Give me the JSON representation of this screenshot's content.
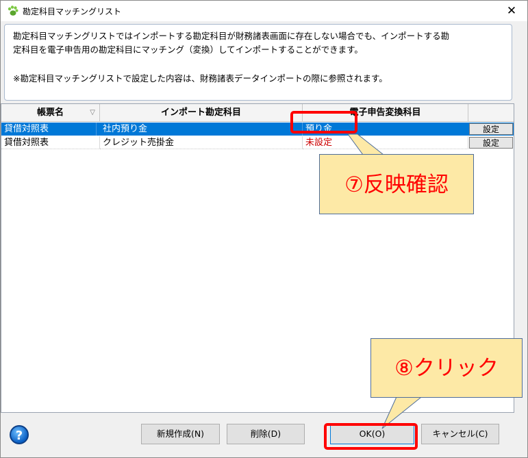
{
  "window": {
    "title": "勘定科目マッチングリスト",
    "close_glyph": "✕"
  },
  "info": {
    "line1": "勘定科目マッチングリストではインポートする勘定科目が財務諸表画面に存在しない場合でも、インポートする勘",
    "line2": "定科目を電子申告用の勘定科目にマッチング（変換）してインポートすることができます。",
    "line3": "※勘定科目マッチングリストで設定した内容は、財務諸表データインポートの際に参照されます。"
  },
  "table": {
    "columns": [
      "帳票名",
      "インポート勘定科目",
      "電子申告変換科目",
      ""
    ],
    "sort_glyph": "▽",
    "rows": [
      {
        "form": "貸借対照表",
        "import_account": "社内預り金",
        "converted": "預り金",
        "button": "設定",
        "selected": true
      },
      {
        "form": "貸借対照表",
        "import_account": "クレジット売掛金",
        "converted": "未設定",
        "button": "設定",
        "selected": false
      }
    ]
  },
  "buttons": {
    "new": "新規作成(N)",
    "delete": "削除(D)",
    "ok": "OK(O)",
    "cancel": "キャンセル(C)",
    "help": "?"
  },
  "annotations": {
    "callout1": "⑦反映確認",
    "callout2": "⑧クリック"
  },
  "colors": {
    "selected_row": "#0078d7",
    "unset_text": "#cc0000",
    "highlight": "#ff0000",
    "callout_fill": "#fde9a6"
  }
}
